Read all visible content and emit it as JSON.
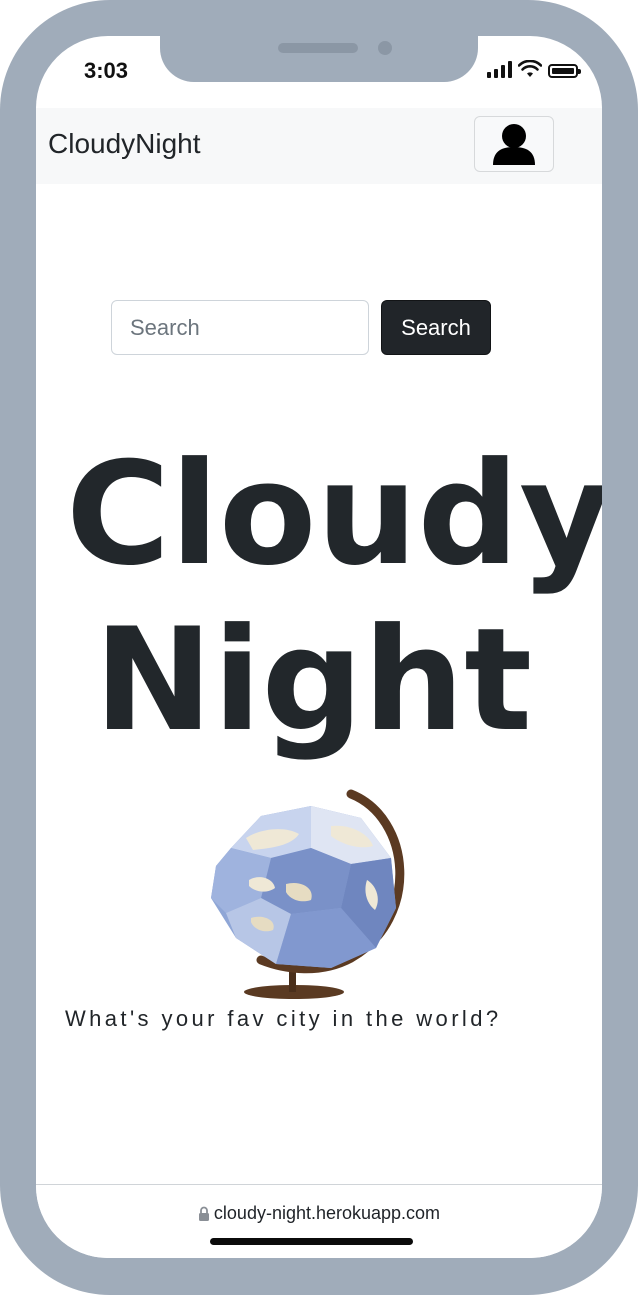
{
  "status_bar": {
    "time": "3:03"
  },
  "navbar": {
    "brand": "CloudyNight",
    "profile_icon": "person-icon"
  },
  "search": {
    "placeholder": "Search",
    "value": "",
    "button_label": "Search"
  },
  "hero": {
    "line1": "Cloudy",
    "line2": "Night",
    "image": "globe-illustration"
  },
  "tagline": "What's your fav city in the world?",
  "browser": {
    "url": "cloudy-night.herokuapp.com",
    "lock_icon": "lock-icon"
  },
  "colors": {
    "frame": "#a0acba",
    "button_dark": "#212529",
    "navbar_bg": "#f7f8f9"
  }
}
